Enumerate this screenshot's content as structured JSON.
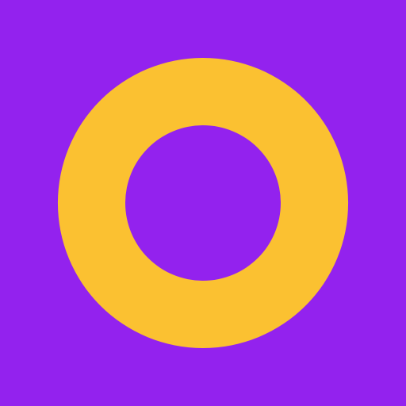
{
  "icon": {
    "name": "ring-icon",
    "background_color": "#9322EE",
    "ring_color": "#FBC131"
  }
}
